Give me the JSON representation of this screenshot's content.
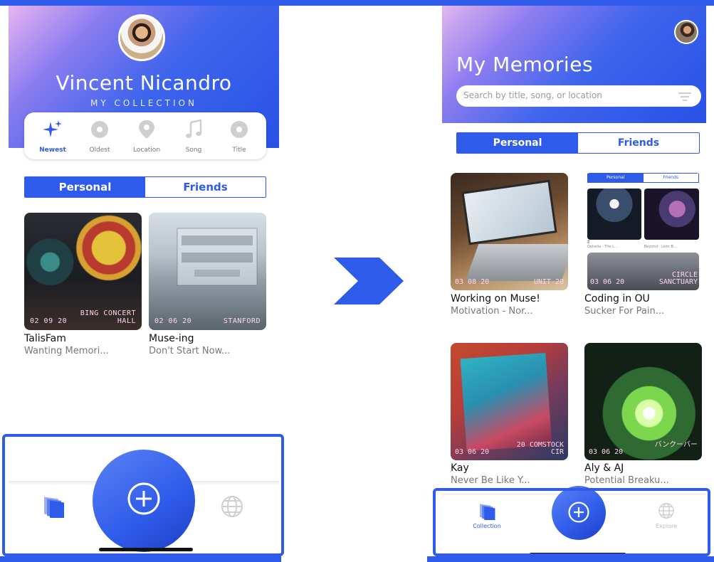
{
  "left_screen": {
    "profile": {
      "name": "Vincent Nicandro",
      "subtitle": "MY COLLECTION"
    },
    "sort_options": [
      {
        "label": "Newest",
        "icon": "sparkles-icon",
        "active": true
      },
      {
        "label": "Oldest",
        "icon": "circle-icon",
        "active": false
      },
      {
        "label": "Location",
        "icon": "location-pin-icon",
        "active": false
      },
      {
        "label": "Song",
        "icon": "music-note-icon",
        "active": false
      },
      {
        "label": "Title",
        "icon": "circle-icon",
        "active": false
      }
    ],
    "segments": {
      "personal": "Personal",
      "friends": "Friends"
    },
    "memories": [
      {
        "title": "TalisFam",
        "song": "Wanting Memori...",
        "date": "02 09 20",
        "location_line1": "BING CONCERT",
        "location_line2": "HALL"
      },
      {
        "title": "Muse-ing",
        "song": "Don't Start Now...",
        "date": "02 06 20",
        "location_line1": "",
        "location_line2": "STANFORD"
      }
    ]
  },
  "right_screen": {
    "title": "My Memories",
    "search": {
      "placeholder": "Search by title, song, or location"
    },
    "segments": {
      "personal": "Personal",
      "friends": "Friends"
    },
    "memories": [
      {
        "title": "Working on Muse!",
        "song": "Motivation - Nor...",
        "date": "03 08 20",
        "location_line1": "",
        "location_line2": "UNIT 20"
      },
      {
        "title": "Coding in OU",
        "song": "Sucker For Pain...",
        "date": "03 06 20",
        "location_line1": "CIRCLE",
        "location_line2": "SANCTUARY"
      },
      {
        "title": "Kay",
        "song": "Never Be Like Y...",
        "date": "03 06 20",
        "location_line1": "20 COMSTOCK",
        "location_line2": "CIR"
      },
      {
        "title": "Aly & AJ",
        "song": "Potential Breaku...",
        "date": "03 06 20",
        "location_line1": "",
        "location_line2": "バンクーバー"
      }
    ],
    "mini_screenshot": {
      "tabs": [
        "Personal",
        "Friends"
      ],
      "captions": [
        "Z",
        "Ophelia - The L...",
        "Beyond - Leon B..."
      ]
    },
    "tabs": {
      "collection": "Collection",
      "explore": "Explore"
    }
  },
  "colors": {
    "accent": "#2f5bea",
    "stamp": "#ffd6ee",
    "gradient_start": "#e9b4f0"
  }
}
